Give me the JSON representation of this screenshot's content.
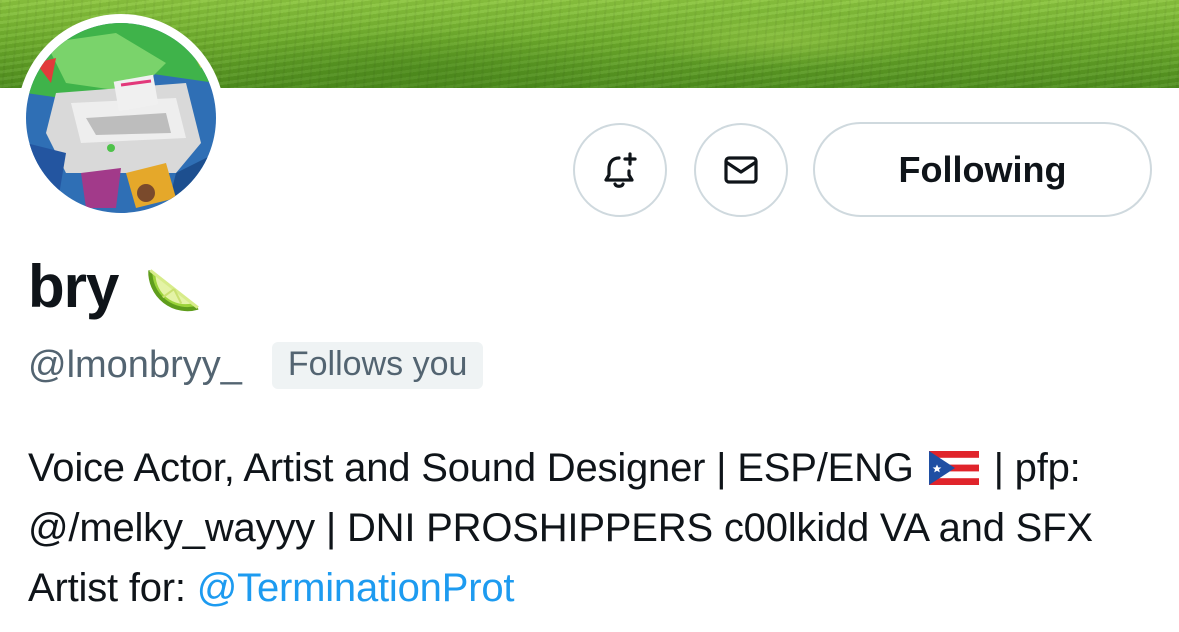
{
  "profile": {
    "display_name": "bry",
    "name_emoji_icon": "lime-emoji",
    "handle": "@lmonbryy_",
    "follows_you_label": "Follows you"
  },
  "actions": {
    "notify_icon": "bell-plus-icon",
    "message_icon": "envelope-icon",
    "following_label": "Following"
  },
  "bio": {
    "part1": "Voice Actor, Artist and Sound Designer | ESP/ENG",
    "flag_icon": "puerto-rico-flag",
    "part2": "| pfp: @/melky_wayyy | DNI PROSHIPPERS c00lkidd VA and SFX Artist for:",
    "mention": "@TerminationProt"
  },
  "colors": {
    "link": "#1d9bf0",
    "secondary_text": "#536471",
    "border": "#cfd9de",
    "banner": "#6fae2c"
  }
}
